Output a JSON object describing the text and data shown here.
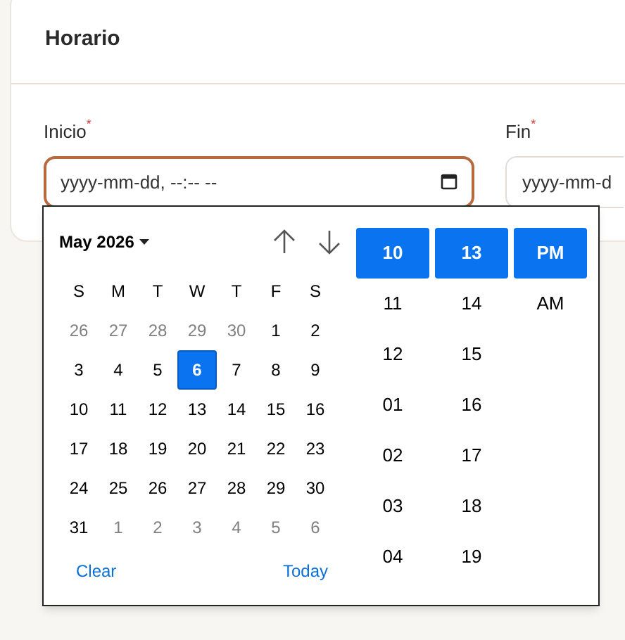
{
  "card": {
    "title": "Horario"
  },
  "fields": [
    {
      "label": "Inicio",
      "required_mark": "*",
      "placeholder": "yyyy-mm-dd, --:-- --",
      "focused": true
    },
    {
      "label": "Fin",
      "required_mark": "*",
      "placeholder": "yyyy-mm-d",
      "focused": false
    }
  ],
  "picker": {
    "month_label": "May 2026",
    "weekdays": [
      "S",
      "M",
      "T",
      "W",
      "T",
      "F",
      "S"
    ],
    "weeks": [
      [
        {
          "day": "26",
          "muted": true,
          "selected": false
        },
        {
          "day": "27",
          "muted": true,
          "selected": false
        },
        {
          "day": "28",
          "muted": true,
          "selected": false
        },
        {
          "day": "29",
          "muted": true,
          "selected": false
        },
        {
          "day": "30",
          "muted": true,
          "selected": false
        },
        {
          "day": "1",
          "muted": false,
          "selected": false
        },
        {
          "day": "2",
          "muted": false,
          "selected": false
        }
      ],
      [
        {
          "day": "3",
          "muted": false,
          "selected": false
        },
        {
          "day": "4",
          "muted": false,
          "selected": false
        },
        {
          "day": "5",
          "muted": false,
          "selected": false
        },
        {
          "day": "6",
          "muted": false,
          "selected": true
        },
        {
          "day": "7",
          "muted": false,
          "selected": false
        },
        {
          "day": "8",
          "muted": false,
          "selected": false
        },
        {
          "day": "9",
          "muted": false,
          "selected": false
        }
      ],
      [
        {
          "day": "10",
          "muted": false,
          "selected": false
        },
        {
          "day": "11",
          "muted": false,
          "selected": false
        },
        {
          "day": "12",
          "muted": false,
          "selected": false
        },
        {
          "day": "13",
          "muted": false,
          "selected": false
        },
        {
          "day": "14",
          "muted": false,
          "selected": false
        },
        {
          "day": "15",
          "muted": false,
          "selected": false
        },
        {
          "day": "16",
          "muted": false,
          "selected": false
        }
      ],
      [
        {
          "day": "17",
          "muted": false,
          "selected": false
        },
        {
          "day": "18",
          "muted": false,
          "selected": false
        },
        {
          "day": "19",
          "muted": false,
          "selected": false
        },
        {
          "day": "20",
          "muted": false,
          "selected": false
        },
        {
          "day": "21",
          "muted": false,
          "selected": false
        },
        {
          "day": "22",
          "muted": false,
          "selected": false
        },
        {
          "day": "23",
          "muted": false,
          "selected": false
        }
      ],
      [
        {
          "day": "24",
          "muted": false,
          "selected": false
        },
        {
          "day": "25",
          "muted": false,
          "selected": false
        },
        {
          "day": "26",
          "muted": false,
          "selected": false
        },
        {
          "day": "27",
          "muted": false,
          "selected": false
        },
        {
          "day": "28",
          "muted": false,
          "selected": false
        },
        {
          "day": "29",
          "muted": false,
          "selected": false
        },
        {
          "day": "30",
          "muted": false,
          "selected": false
        }
      ],
      [
        {
          "day": "31",
          "muted": false,
          "selected": false
        },
        {
          "day": "1",
          "muted": true,
          "selected": false
        },
        {
          "day": "2",
          "muted": true,
          "selected": false
        },
        {
          "day": "3",
          "muted": true,
          "selected": false
        },
        {
          "day": "4",
          "muted": true,
          "selected": false
        },
        {
          "day": "5",
          "muted": true,
          "selected": false
        },
        {
          "day": "6",
          "muted": true,
          "selected": false
        }
      ]
    ],
    "footer": [
      "Clear",
      "Today"
    ],
    "time_columns": [
      [
        {
          "text": "10",
          "selected": true
        },
        {
          "text": "11",
          "selected": false
        },
        {
          "text": "12",
          "selected": false
        },
        {
          "text": "01",
          "selected": false
        },
        {
          "text": "02",
          "selected": false
        },
        {
          "text": "03",
          "selected": false
        },
        {
          "text": "04",
          "selected": false
        }
      ],
      [
        {
          "text": "13",
          "selected": true
        },
        {
          "text": "14",
          "selected": false
        },
        {
          "text": "15",
          "selected": false
        },
        {
          "text": "16",
          "selected": false
        },
        {
          "text": "17",
          "selected": false
        },
        {
          "text": "18",
          "selected": false
        },
        {
          "text": "19",
          "selected": false
        }
      ],
      [
        {
          "text": "PM",
          "selected": true
        },
        {
          "text": "AM",
          "selected": false
        }
      ]
    ]
  }
}
